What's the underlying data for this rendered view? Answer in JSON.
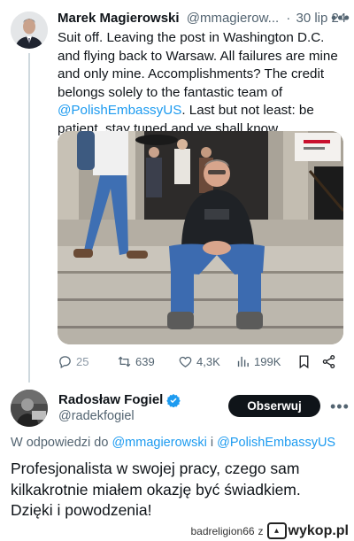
{
  "tweet1": {
    "author_name": "Marek Magierowski",
    "author_handle": "@mmagierow...",
    "separator": "·",
    "date": "30 lip 24",
    "body_before_mention": "Suit off. Leaving the post in Washington D.C. and flying back to Warsaw. All failures are mine and only mine. Accomplishments? The credit belongs solely to the fantastic team of ",
    "mention": "@PolishEmbassyUS",
    "body_after_mention": ". Last but not least: be patient, stay tuned and ye shall know...",
    "actions": {
      "replies": "25",
      "retweets": "639",
      "likes": "4,3K",
      "views": "199K"
    }
  },
  "tweet2": {
    "author_name": "Radosław Fogiel",
    "author_handle": "@radekfogiel",
    "follow_label": "Obserwuj",
    "reply_prefix": "W odpowiedzi do ",
    "reply_mention1": "@mmagierowski",
    "reply_conj": " i ",
    "reply_mention2": "@PolishEmbassyUS",
    "body": "Profesjonalista w swojej pracy, czego sam kilkakrotnie miałem okazję być świadkiem. Dzięki i powodzenia!"
  },
  "watermark": {
    "user": "badreligion66",
    "connector": "z",
    "site": "wykop.pl"
  },
  "colors": {
    "link": "#1d9bf0",
    "secondary": "#536471",
    "primary_text": "#0f1419"
  },
  "icons": [
    "reply-icon",
    "retweet-icon",
    "like-icon",
    "views-icon",
    "bookmark-icon",
    "share-icon",
    "verified-icon",
    "more-icon"
  ]
}
